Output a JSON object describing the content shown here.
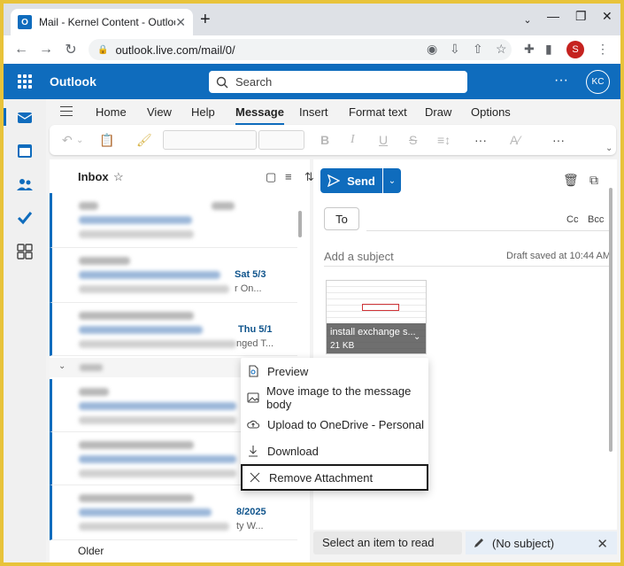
{
  "browser": {
    "tab_title": "Mail - Kernel Content - Outlook",
    "tab_favicon": "O",
    "url": "outlook.live.com/mail/0/",
    "profile_initial": "S"
  },
  "header": {
    "brand": "Outlook",
    "search_placeholder": "Search",
    "more": "···",
    "avatar_initials": "KC"
  },
  "ribbon": {
    "tabs": [
      "Home",
      "View",
      "Help",
      "Message",
      "Insert",
      "Format text",
      "Draw",
      "Options"
    ],
    "active_tab": "Message"
  },
  "list": {
    "title": "Inbox",
    "rows": [
      {
        "date": "",
        "tail": ""
      },
      {
        "date": "Sat 5/3",
        "tail": "r On..."
      },
      {
        "date": "Thu 5/1",
        "tail": "nged T..."
      },
      {
        "date": "",
        "tail": ""
      },
      {
        "date": "",
        "tail": ""
      },
      {
        "date": "8/2025",
        "tail": "ty W..."
      }
    ],
    "older_label": "Older"
  },
  "compose": {
    "send_label": "Send",
    "to_label": "To",
    "cc_label": "Cc",
    "bcc_label": "Bcc",
    "subject_placeholder": "Add a subject",
    "draft_status": "Draft saved at 10:44 AM",
    "attachment": {
      "name": "install exchange s...",
      "size": "21 KB"
    }
  },
  "context_menu": {
    "items": [
      {
        "label": "Preview",
        "icon": "preview-icon"
      },
      {
        "label": "Move image to the message body",
        "icon": "image-icon"
      },
      {
        "label": "Upload to OneDrive - Personal",
        "icon": "cloud-upload-icon"
      },
      {
        "label": "Download",
        "icon": "download-icon"
      },
      {
        "label": "Remove Attachment",
        "icon": "close-icon"
      }
    ],
    "highlighted_index": 4
  },
  "bottom_bar": {
    "select_label": "Select an item to read",
    "draft_label": "(No subject)"
  },
  "colors": {
    "brand_blue": "#0f6cbd",
    "frame_yellow": "#e8c33a"
  }
}
